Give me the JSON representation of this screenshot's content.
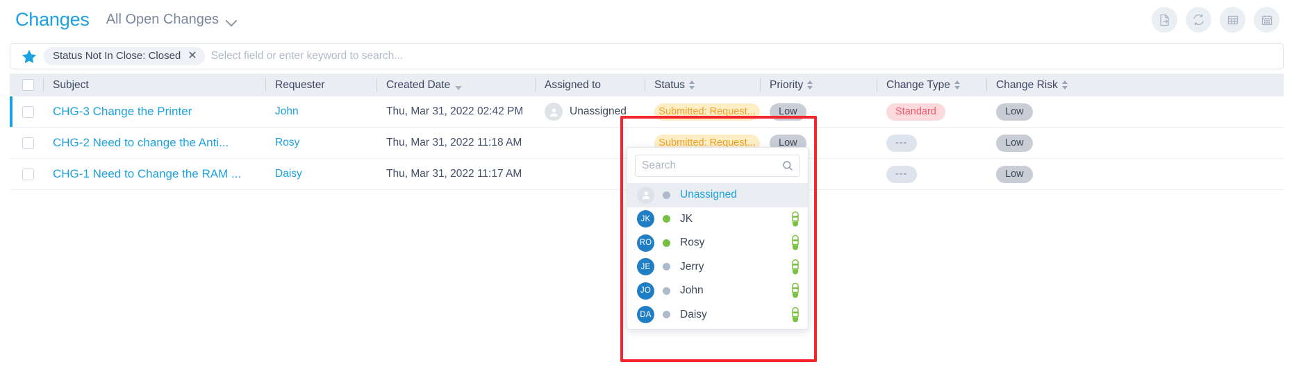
{
  "header": {
    "title": "Changes",
    "view_name": "All Open Changes",
    "chevron_icon": "chevron-down-icon",
    "actions": [
      {
        "name": "export-icon",
        "title": "Export"
      },
      {
        "name": "refresh-icon",
        "title": "Refresh"
      },
      {
        "name": "grid-view-icon",
        "title": "Table view"
      },
      {
        "name": "calendar-icon",
        "title": "Calendar view"
      }
    ]
  },
  "filter_bar": {
    "star_icon": "star-icon",
    "chip_label": "Status Not In Close: Closed",
    "chip_remove": "✕",
    "search_value": "",
    "search_placeholder": "Select field or enter keyword to search..."
  },
  "table": {
    "columns": [
      {
        "key": "subject",
        "label": "Subject",
        "sort": "none"
      },
      {
        "key": "requester",
        "label": "Requester",
        "sort": "none"
      },
      {
        "key": "created",
        "label": "Created Date",
        "sort": "desc"
      },
      {
        "key": "assigned",
        "label": "Assigned to",
        "sort": "none"
      },
      {
        "key": "status",
        "label": "Status",
        "sort": "both"
      },
      {
        "key": "priority",
        "label": "Priority",
        "sort": "both"
      },
      {
        "key": "type",
        "label": "Change Type",
        "sort": "both"
      },
      {
        "key": "risk",
        "label": "Change Risk",
        "sort": "both"
      }
    ],
    "rows": [
      {
        "subject": "CHG-3 Change the Printer",
        "requester": "John",
        "created": "Thu, Mar 31, 2022 02:42 PM",
        "assigned": "Unassigned",
        "status": "Submitted: Request...",
        "priority": "Low",
        "type": "Standard",
        "type_style": "pink",
        "risk": "Low"
      },
      {
        "subject": "CHG-2 Need to change the Anti...",
        "requester": "Rosy",
        "created": "Thu, Mar 31, 2022 11:18 AM",
        "assigned": "",
        "status": "Submitted: Request...",
        "priority": "Low",
        "type": "---",
        "type_style": "dash",
        "risk": "Low"
      },
      {
        "subject": "CHG-1 Need to Change the RAM ...",
        "requester": "Daisy",
        "created": "Thu, Mar 31, 2022 11:17 AM",
        "assigned": "",
        "status": "Submitted: Request...",
        "priority": "Low",
        "type": "---",
        "type_style": "dash",
        "risk": "Low"
      }
    ]
  },
  "assignee_dropdown": {
    "search_value": "",
    "search_placeholder": "Search",
    "search_icon": "search-icon",
    "options": [
      {
        "initials": "",
        "name": "Unassigned",
        "presence": "offline",
        "selected": true,
        "generic": true,
        "load": false
      },
      {
        "initials": "JK",
        "name": "JK",
        "presence": "online",
        "selected": false,
        "generic": false,
        "load": true
      },
      {
        "initials": "RO",
        "name": "Rosy",
        "presence": "online",
        "selected": false,
        "generic": false,
        "load": true
      },
      {
        "initials": "JE",
        "name": "Jerry",
        "presence": "offline",
        "selected": false,
        "generic": false,
        "load": true
      },
      {
        "initials": "JO",
        "name": "John",
        "presence": "offline",
        "selected": false,
        "generic": false,
        "load": true
      },
      {
        "initials": "DA",
        "name": "Daisy",
        "presence": "offline",
        "selected": false,
        "generic": false,
        "load": true
      }
    ]
  },
  "colors": {
    "accent": "#1ca2e0",
    "annotation": "#f8252c",
    "status_badge_bg": "#fdeec6",
    "status_badge_fg": "#f0a029",
    "grey_badge": "#c9ced6",
    "pink_badge": "#fbd9dc",
    "online": "#78c044",
    "offline": "#adbbcd"
  }
}
